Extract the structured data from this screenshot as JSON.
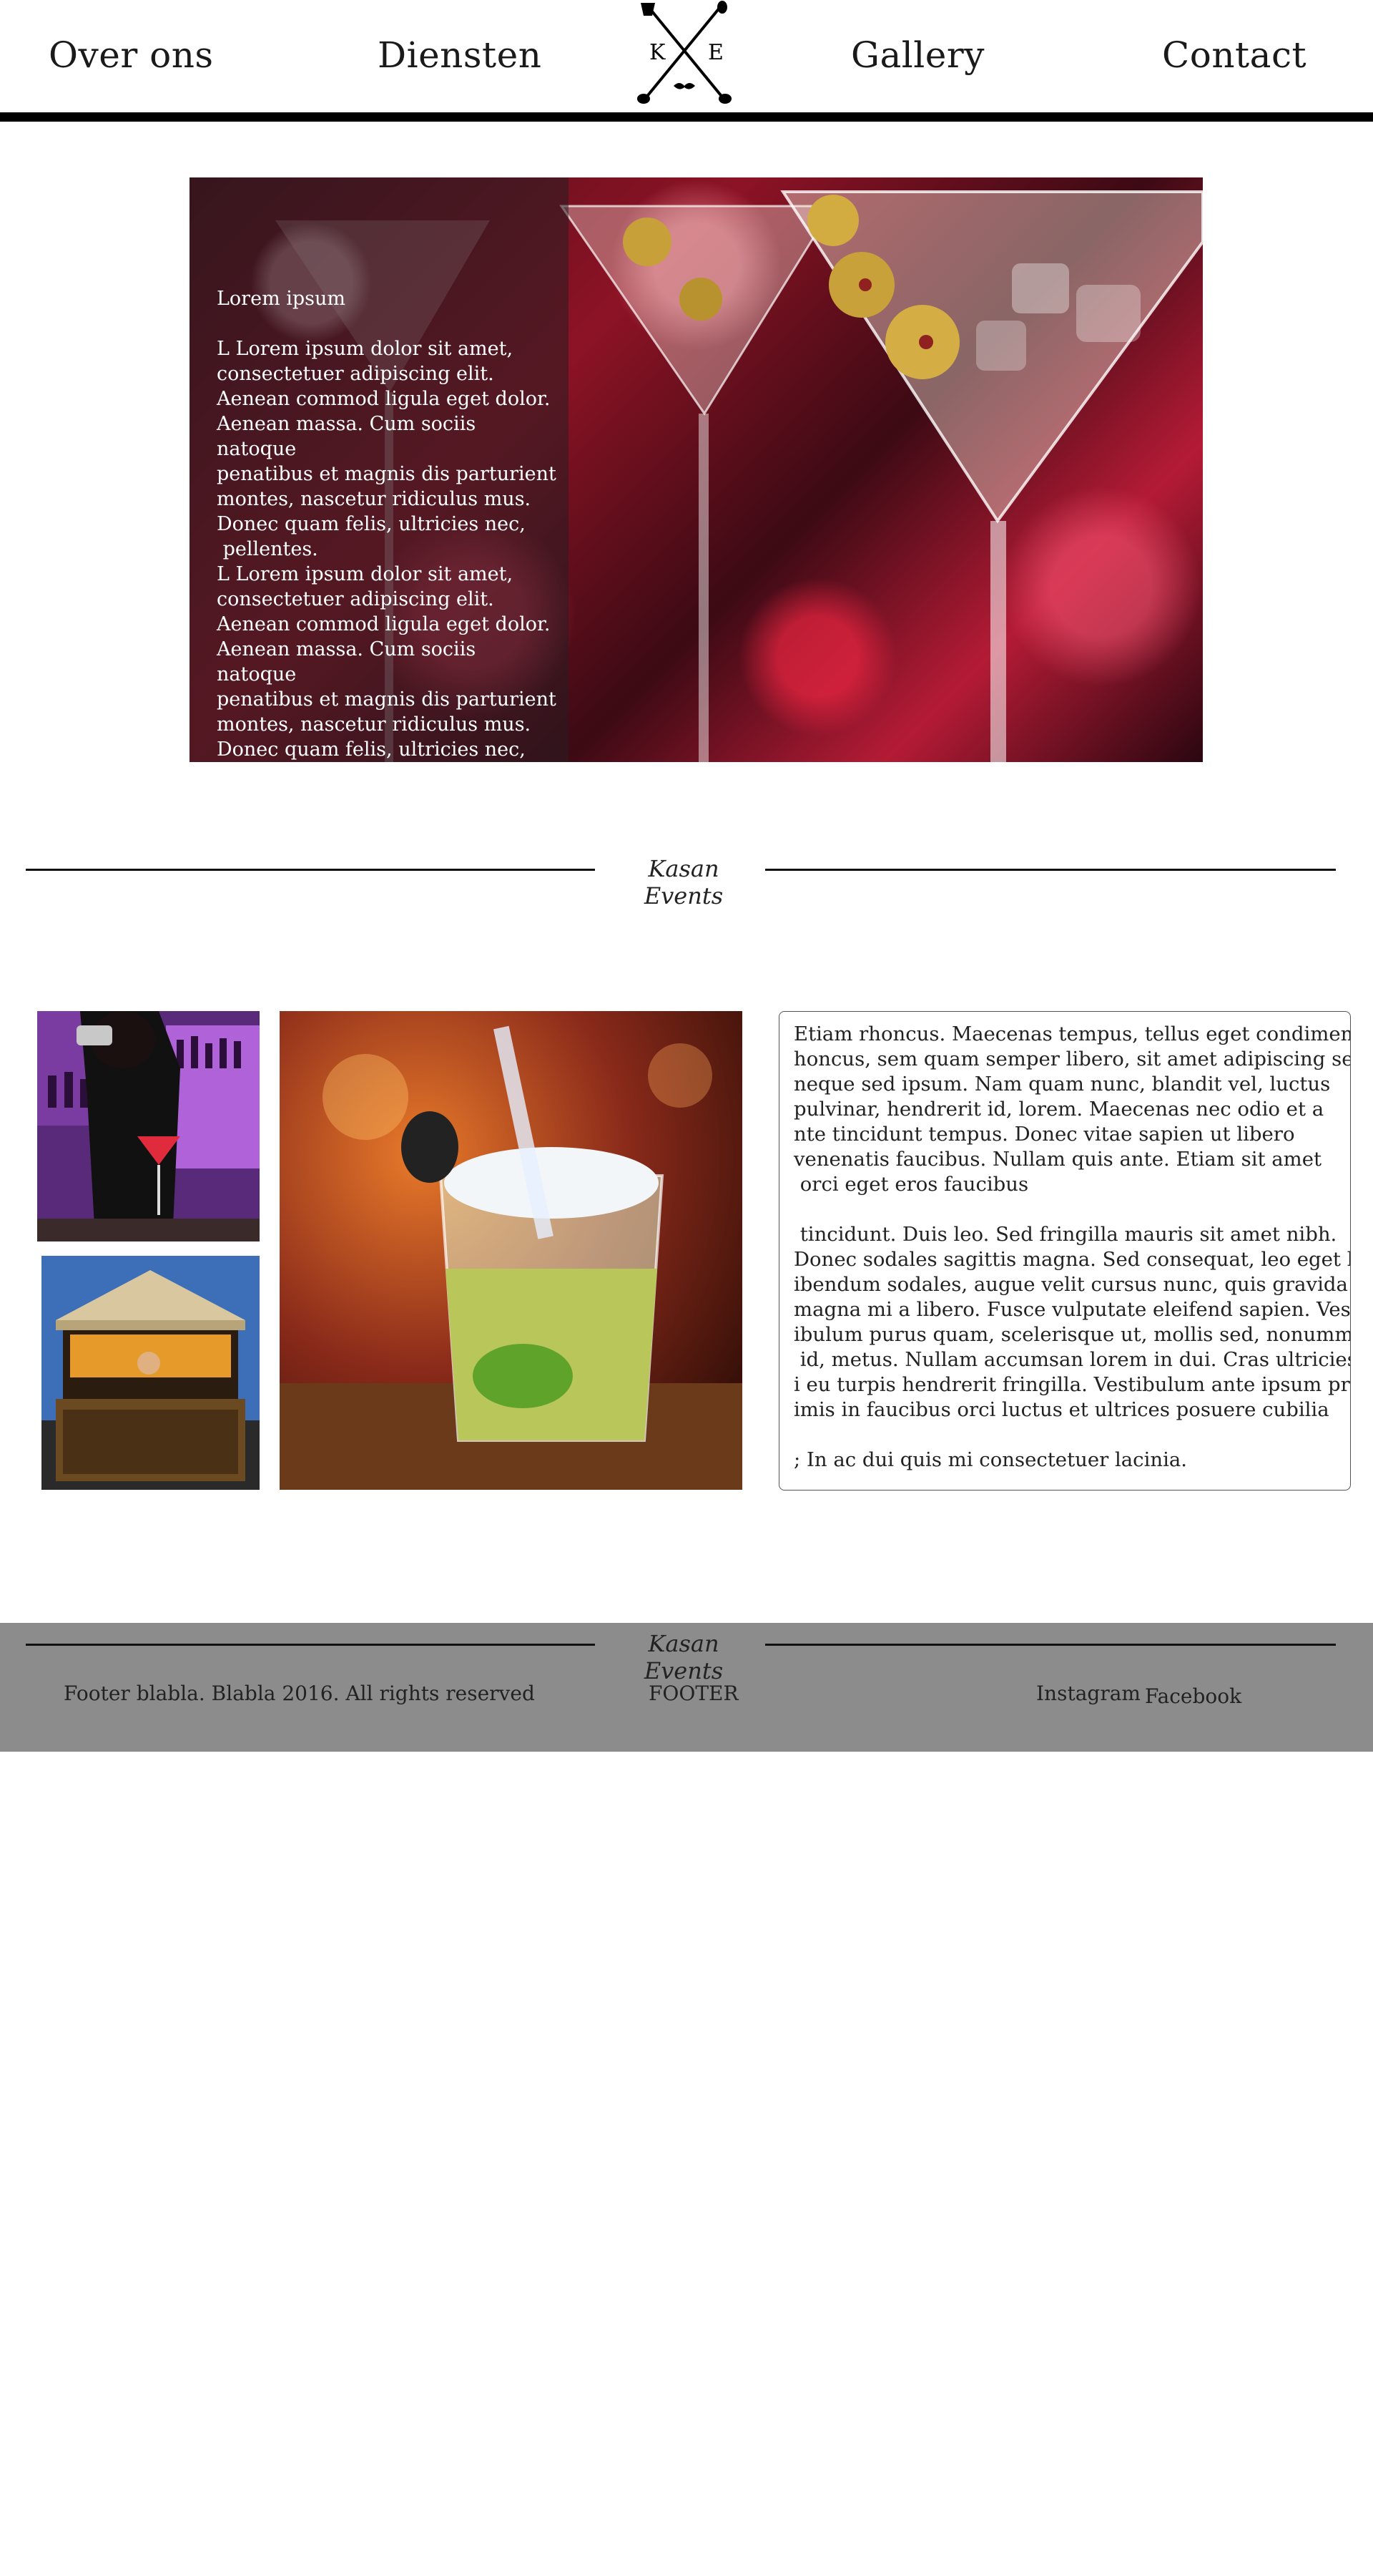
{
  "nav": {
    "about": "Over ons",
    "services": "Diensten",
    "gallery": "Gallery",
    "contact": "Contact",
    "logo": {
      "left_letter": "K",
      "right_letter": "E"
    }
  },
  "hero": {
    "title": "Lorem ipsum",
    "body": "L Lorem ipsum dolor sit amet,\nconsectetuer adipiscing elit.\nAenean commod ligula eget dolor.\nAenean massa. Cum sociis natoque\npenatibus et magnis dis parturient\nmontes, nascetur ridiculus mus.\nDonec quam felis, ultricies nec,\n pellentes.\nL Lorem ipsum dolor sit amet,\nconsectetuer adipiscing elit.\nAenean commod ligula eget dolor.\nAenean massa. Cum sociis natoque\npenatibus et magnis dis parturient\nmontes, nascetur ridiculus mus.\nDonec quam felis, ultricies nec,\n pellentes."
  },
  "divider": {
    "brand": "Kasan Events"
  },
  "info": {
    "para1": "Etiam rhoncus. Maecenas tempus, tellus eget condimentum\nhoncus, sem quam semper libero, sit amet adipiscing sem\nneque sed ipsum. Nam quam nunc, blandit vel, luctus\npulvinar, hendrerit id, lorem. Maecenas nec odio et a\nnte tincidunt tempus. Donec vitae sapien ut libero\nvenenatis faucibus. Nullam quis ante. Etiam sit amet\n orci eget eros faucibus",
    "para2": " tincidunt. Duis leo. Sed fringilla mauris sit amet nibh.\nDonec sodales sagittis magna. Sed consequat, leo eget b\nibendum sodales, augue velit cursus nunc, quis gravida\nmagna mi a libero. Fusce vulputate eleifend sapien. Vest\nibulum purus quam, scelerisque ut, mollis sed, nonummy\n id, metus. Nullam accumsan lorem in dui. Cras ultricies m\ni eu turpis hendrerit fringilla. Vestibulum ante ipsum pr\nimis in faucibus orci luctus et ultrices posuere cubilia",
    "para3": "; In ac dui quis mi consectetuer lacinia."
  },
  "footer": {
    "brand": "Kasan Events",
    "copyright": "Footer blabla. Blabla 2016. All rights reserved",
    "label": "FOOTER",
    "instagram": "Instagram",
    "facebook": "Facebook",
    "background": "#8c8c8c"
  }
}
